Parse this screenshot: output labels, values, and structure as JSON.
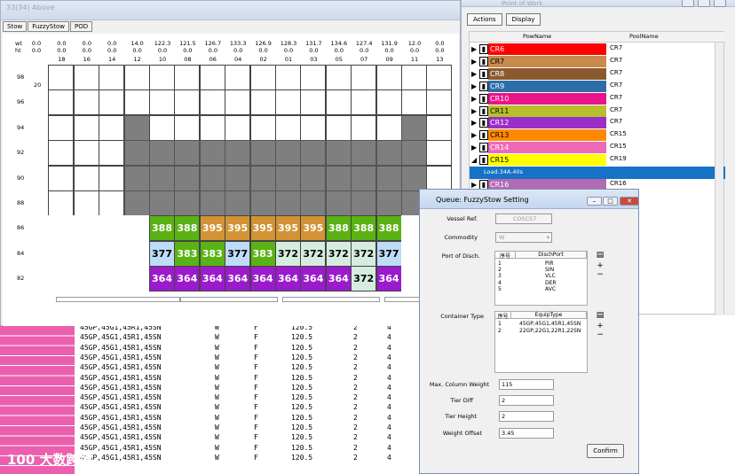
{
  "bg_list": {
    "row_code": "45GP,45G1,45R1,45SN",
    "row_w": "W",
    "row_f": "F",
    "row_weight": "120.5",
    "row_a": "2",
    "row_b": "4",
    "row_count": 14,
    "watermark": "100 大数跨境"
  },
  "bay_window": {
    "title": "33(34) Above",
    "tabs": [
      "Stow",
      "FuzzyStow",
      "POD"
    ],
    "wt_label": "wt",
    "ht_label": "ht",
    "columns": [
      {
        "wt": "0.0",
        "ht": "0.0",
        "no": ""
      },
      {
        "wt": "0.0",
        "ht": "0.0",
        "no": "18"
      },
      {
        "wt": "0.0",
        "ht": "0.0",
        "no": "16"
      },
      {
        "wt": "0.0",
        "ht": "0.0",
        "no": "14"
      },
      {
        "wt": "14.0",
        "ht": "0.0",
        "no": "12"
      },
      {
        "wt": "122.3",
        "ht": "0.0",
        "no": "10"
      },
      {
        "wt": "121.5",
        "ht": "0.0",
        "no": "08"
      },
      {
        "wt": "126.7",
        "ht": "0.0",
        "no": "06"
      },
      {
        "wt": "133.3",
        "ht": "0.0",
        "no": "04"
      },
      {
        "wt": "126.9",
        "ht": "0.0",
        "no": "02"
      },
      {
        "wt": "128.3",
        "ht": "0.0",
        "no": "01"
      },
      {
        "wt": "131.7",
        "ht": "0.0",
        "no": "03"
      },
      {
        "wt": "134.6",
        "ht": "0.0",
        "no": "05"
      },
      {
        "wt": "127.4",
        "ht": "0.0",
        "no": "07"
      },
      {
        "wt": "131.9",
        "ht": "0.0",
        "no": "09"
      },
      {
        "wt": "12.0",
        "ht": "0.0",
        "no": "11"
      },
      {
        "wt": "0.0",
        "ht": "0.0",
        "no": "13"
      }
    ],
    "tiers": [
      "98",
      "96",
      "94",
      "92",
      "90",
      "88",
      "86",
      "84",
      "82"
    ],
    "extra_label": "20",
    "row86": [
      {
        "v": "388",
        "c": "#5ab214"
      },
      {
        "v": "388",
        "c": "#5ab214"
      },
      {
        "v": "395",
        "c": "#d39334"
      },
      {
        "v": "395",
        "c": "#d39334"
      },
      {
        "v": "395",
        "c": "#d39334"
      },
      {
        "v": "395",
        "c": "#d39334"
      },
      {
        "v": "395",
        "c": "#d39334"
      },
      {
        "v": "388",
        "c": "#5ab214"
      },
      {
        "v": "388",
        "c": "#5ab214"
      },
      {
        "v": "388",
        "c": "#5ab214"
      }
    ],
    "row84": [
      {
        "v": "377",
        "c": "#bcdcf7"
      },
      {
        "v": "383",
        "c": "#5ab214"
      },
      {
        "v": "383",
        "c": "#5ab214"
      },
      {
        "v": "377",
        "c": "#bcdcf7"
      },
      {
        "v": "383",
        "c": "#5ab214"
      },
      {
        "v": "372",
        "c": "#d6ecdf"
      },
      {
        "v": "372",
        "c": "#d6ecdf"
      },
      {
        "v": "372",
        "c": "#d6ecdf"
      },
      {
        "v": "372",
        "c": "#d6ecdf"
      },
      {
        "v": "377",
        "c": "#bcdcf7"
      }
    ],
    "row82": [
      {
        "v": "364",
        "c": "#9b1bcc"
      },
      {
        "v": "364",
        "c": "#9b1bcc"
      },
      {
        "v": "364",
        "c": "#9b1bcc"
      },
      {
        "v": "364",
        "c": "#9b1bcc"
      },
      {
        "v": "364",
        "c": "#9b1bcc"
      },
      {
        "v": "364",
        "c": "#9b1bcc"
      },
      {
        "v": "364",
        "c": "#9b1bcc"
      },
      {
        "v": "364",
        "c": "#9b1bcc"
      },
      {
        "v": "372",
        "c": "#d6ecdf"
      },
      {
        "v": "364",
        "c": "#9b1bcc"
      }
    ]
  },
  "pow_window": {
    "title": "Point of Work",
    "actions_label": "Actions",
    "display_label": "Display",
    "col_pow": "PowName",
    "col_pool": "PoolName",
    "rows": [
      {
        "name": "CR6",
        "pool": "CR7",
        "color": "#ff0000"
      },
      {
        "name": "CR7",
        "pool": "CR7",
        "color": "#c98a4a"
      },
      {
        "name": "CR8",
        "pool": "CR7",
        "color": "#8a5a2e"
      },
      {
        "name": "CR9",
        "pool": "CR7",
        "color": "#2d6ea8"
      },
      {
        "name": "CR10",
        "pool": "CR7",
        "color": "#e8148a"
      },
      {
        "name": "CR11",
        "pool": "CR7",
        "color": "#b5c02a"
      },
      {
        "name": "CR12",
        "pool": "CR7",
        "color": "#9a2ec8"
      },
      {
        "name": "CR13",
        "pool": "CR15",
        "color": "#ff8a00"
      },
      {
        "name": "CR14",
        "pool": "CR15",
        "color": "#ee6ab8"
      },
      {
        "name": "CR15",
        "pool": "CR19",
        "color": "#ffff00"
      },
      {
        "name": "CR16",
        "pool": "CR16",
        "color": "#b36ab5"
      }
    ],
    "sub_row": "Load.34A.40s"
  },
  "dialog": {
    "title": "Queue: FuzzyStow Setting",
    "vessel_label": "Vessel Ref.",
    "vessel_value": "COSCS7",
    "commodity_label": "Commodity",
    "commodity_value": "W",
    "pod_label": "Port of Disch.",
    "pod_col1": "序号",
    "pod_col2": "DischPort",
    "pod_rows": [
      {
        "n": "1",
        "p": "PIR"
      },
      {
        "n": "2",
        "p": "SIN"
      },
      {
        "n": "3",
        "p": "VLC"
      },
      {
        "n": "4",
        "p": "DER"
      },
      {
        "n": "5",
        "p": "AVC"
      }
    ],
    "ctype_label": "Container Type",
    "ct_col1": "序号",
    "ct_col2": "EquipType",
    "ct_rows": [
      {
        "n": "1",
        "t": "45GP,45G1,45R1,45SN"
      },
      {
        "n": "2",
        "t": "22GP,22G1,22R1,22SN"
      }
    ],
    "max_col_label": "Max. Column Weight",
    "max_col_value": "115",
    "tier_diff_label": "Tier Diff",
    "tier_diff_value": "2",
    "tier_height_label": "Tier Height",
    "tier_height_value": "2",
    "weight_offset_label": "Weight Offset",
    "weight_offset_value": "3.45",
    "confirm_label": "Confirm"
  }
}
